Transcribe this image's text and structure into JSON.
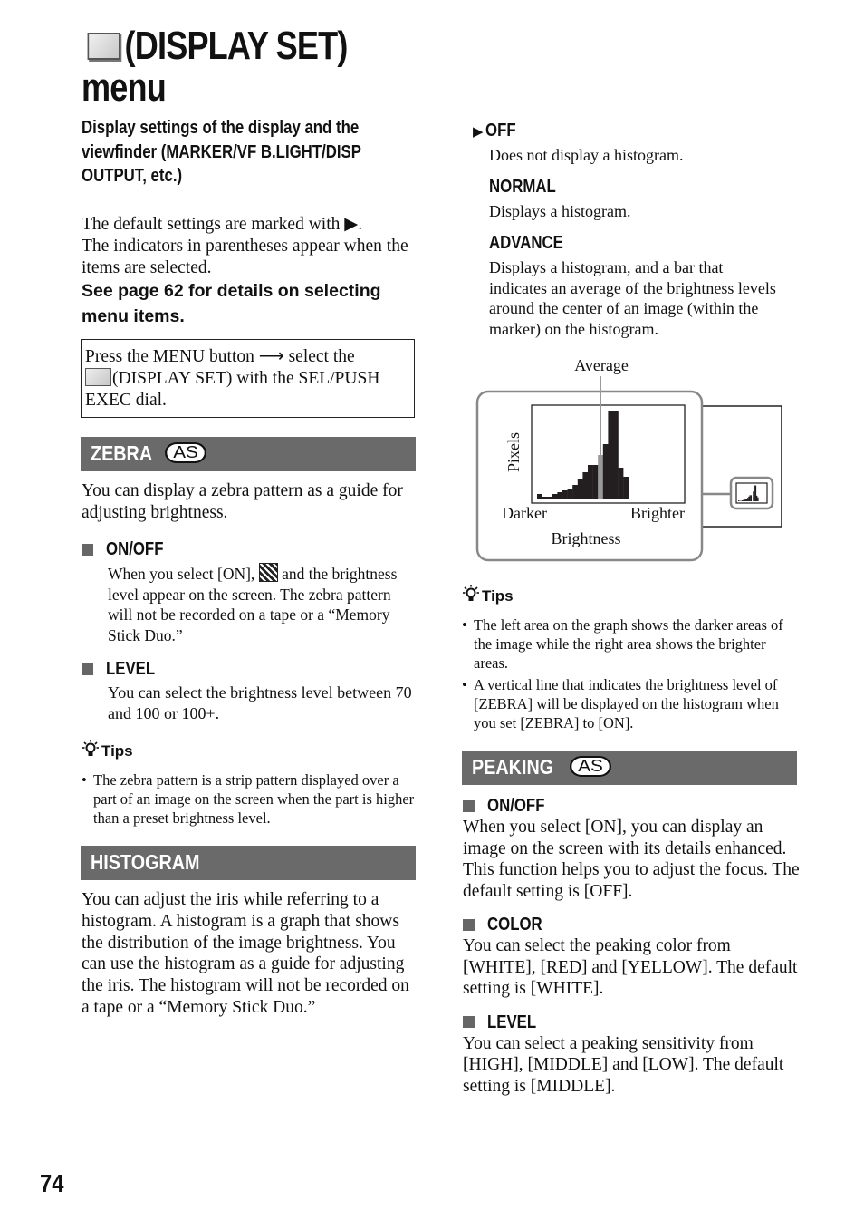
{
  "title": {
    "icon": "display-set-icon",
    "line1": "(DISPLAY SET)",
    "line2": "menu"
  },
  "subtitle": "Display settings of the display and the viewfinder (MARKER/VF B.LIGHT/DISP OUTPUT, etc.)",
  "intro": {
    "line1": "The default settings are marked with ▶.",
    "line2": "The indicators in parentheses appear when the items are selected.",
    "see_page": "See page 62 for details on selecting menu items."
  },
  "procedure": {
    "part1": "Press the MENU button ⟶ select the ",
    "part2": "(DISPLAY SET) with the SEL/PUSH EXEC dial."
  },
  "zebra": {
    "title": "ZEBRA",
    "badge": "AS",
    "description": "You can display a zebra pattern as a guide for adjusting brightness.",
    "items": [
      {
        "head": "ON/OFF",
        "text_before_icon": "When you select [ON], ",
        "text_after_icon": " and the brightness level appear on the screen. The zebra pattern will not be recorded on a tape or a “Memory Stick Duo.”"
      },
      {
        "head": "LEVEL",
        "text": "You can select the brightness level between 70 and 100 or 100+."
      }
    ],
    "tips_label": "Tips",
    "tips": [
      "The zebra pattern is a strip pattern displayed over a part of an image on the screen when the part is higher than a preset brightness level."
    ]
  },
  "histogram": {
    "title": "HISTOGRAM",
    "description": "You can adjust the iris while referring to a histogram. A histogram is a graph that shows the distribution of the image brightness. You can use the histogram as a guide for adjusting the iris. The histogram will not be recorded on a tape or a “Memory Stick Duo.”",
    "options": [
      {
        "head": "OFF",
        "default": true,
        "text": "Does not display a histogram."
      },
      {
        "head": "NORMAL",
        "default": false,
        "text": "Displays a histogram."
      },
      {
        "head": "ADVANCE",
        "default": false,
        "text": "Displays a histogram, and a bar that indicates an average of the brightness levels around the center of an image (within the marker) on the histogram."
      }
    ],
    "tips_label": "Tips",
    "tips": [
      "The left area on the graph shows the darker areas of the image while the right area shows the brighter areas.",
      "A vertical line that indicates the brightness level of [ZEBRA] will be displayed on the histogram when you set [ZEBRA] to [ON]."
    ]
  },
  "chart_data": {
    "type": "bar",
    "title": "",
    "annotation": "Average",
    "xlabel": "Brightness",
    "ylabel": "Pixels",
    "x_left_label": "Darker",
    "x_right_label": "Brighter",
    "values": [
      5,
      2,
      2,
      5,
      7,
      9,
      11,
      15,
      21,
      29,
      37,
      37,
      48,
      60,
      97,
      97,
      34,
      24
    ],
    "average_bin_index": 12,
    "ylim": [
      0,
      100
    ],
    "colors": {
      "bar": "#231f20",
      "average": "#999999"
    }
  },
  "peaking": {
    "title": "PEAKING",
    "badge": "AS",
    "items": [
      {
        "head": "ON/OFF",
        "text": "When you select [ON], you can display an image on the screen with its details enhanced. This function helps you to adjust the focus. The default setting is [OFF]."
      },
      {
        "head": "COLOR",
        "text": "You can select the peaking color from [WHITE], [RED] and [YELLOW]. The default setting is [WHITE]."
      },
      {
        "head": "LEVEL",
        "text": "You can select a peaking sensitivity from [HIGH], [MIDDLE] and [LOW]. The default setting is [MIDDLE]."
      }
    ]
  },
  "page_number": "74",
  "colors": {
    "section_bar": "#6a6a6a",
    "bullet_square": "#666666"
  }
}
